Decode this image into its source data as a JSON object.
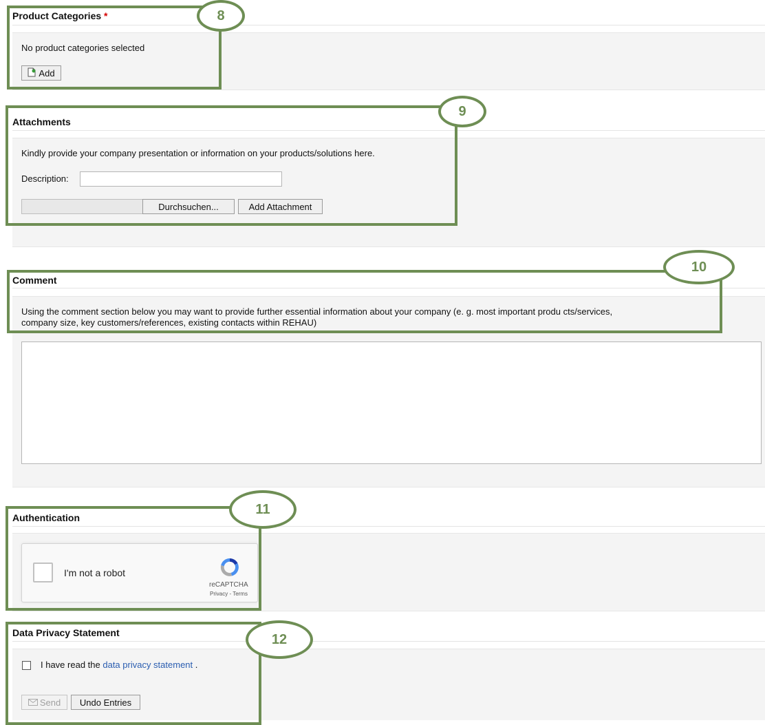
{
  "product_categories": {
    "title": "Product Categories",
    "required_mark": "*",
    "status_text": "No product categories selected",
    "add_label": "Add",
    "badge": "8"
  },
  "attachments": {
    "title": "Attachments",
    "instruction": "Kindly provide your company presentation or information on your products/solutions here.",
    "description_label": "Description:",
    "description_value": "",
    "browse_label": "Durchsuchen...",
    "add_attachment_label": "Add Attachment",
    "badge": "9"
  },
  "comment": {
    "title": "Comment",
    "instruction_line1": "Using the comment section below you may want to provide further essential information about your company (e. g. most important produ cts/services,",
    "instruction_line2": "company size, key customers/references, existing contacts within REHAU)",
    "value": "",
    "badge": "10"
  },
  "authentication": {
    "title": "Authentication",
    "captcha_label": "I'm not a robot",
    "captcha_brand": "reCAPTCHA",
    "captcha_links": "Privacy - Terms",
    "badge": "11"
  },
  "privacy": {
    "title": "Data Privacy Statement",
    "checkbox_prefix": "I have read the",
    "link_text": "data privacy statement",
    "checkbox_suffix": ".",
    "send_label": "Send",
    "undo_label": "Undo Entries",
    "badge": "12"
  },
  "colors": {
    "annotation_green": "#6e8e54",
    "link_blue": "#2a5db0",
    "required_red": "#d60000"
  }
}
